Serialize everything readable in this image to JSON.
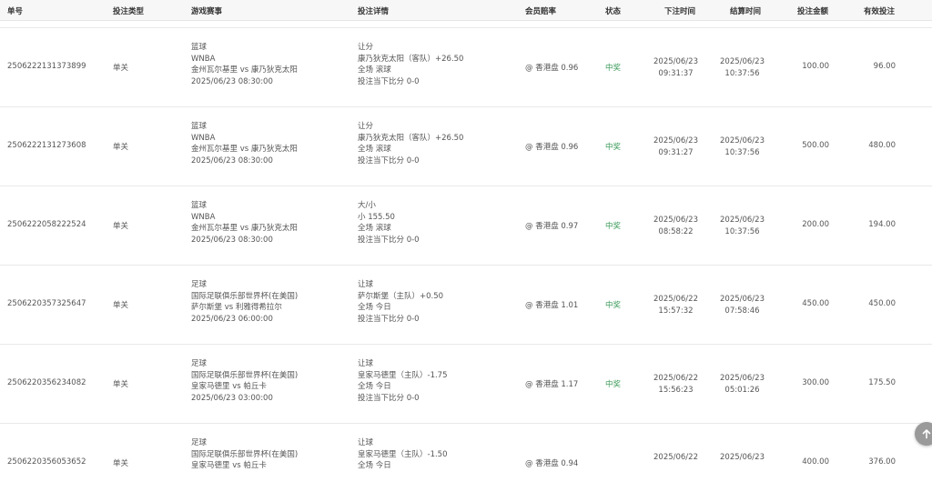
{
  "columns": {
    "order_no": "单号",
    "bet_type": "投注类型",
    "game": "游戏赛事",
    "detail": "投注详情",
    "odds": "会员赔率",
    "status": "状态",
    "bet_time": "下注时间",
    "settle_time": "结算时间",
    "amount": "投注金额",
    "valid": "有效投注"
  },
  "rows": [
    {
      "order_no": "2506222131373899",
      "bet_type": "单关",
      "game": [
        "篮球",
        "WNBA",
        "金州瓦尔基里 vs 康乃狄克太阳",
        "2025/06/23 08:30:00"
      ],
      "detail": [
        "让分",
        "康乃狄克太阳（客队）+26.50",
        "全场 滚球",
        "投注当下比分 0-0"
      ],
      "odds": "@ 香港盘 0.96",
      "status": "中奖",
      "bet_time": [
        "2025/06/23",
        "09:31:37"
      ],
      "settle_time": [
        "2025/06/23",
        "10:37:56"
      ],
      "amount": "100.00",
      "valid": "96.00"
    },
    {
      "order_no": "2506222131273608",
      "bet_type": "单关",
      "game": [
        "篮球",
        "WNBA",
        "金州瓦尔基里 vs 康乃狄克太阳",
        "2025/06/23 08:30:00"
      ],
      "detail": [
        "让分",
        "康乃狄克太阳（客队）+26.50",
        "全场 滚球",
        "投注当下比分 0-0"
      ],
      "odds": "@ 香港盘 0.96",
      "status": "中奖",
      "bet_time": [
        "2025/06/23",
        "09:31:27"
      ],
      "settle_time": [
        "2025/06/23",
        "10:37:56"
      ],
      "amount": "500.00",
      "valid": "480.00"
    },
    {
      "order_no": "2506222058222524",
      "bet_type": "单关",
      "game": [
        "篮球",
        "WNBA",
        "金州瓦尔基里 vs 康乃狄克太阳",
        "2025/06/23 08:30:00"
      ],
      "detail": [
        "大/小",
        "小 155.50",
        "全场 滚球",
        "投注当下比分 0-0"
      ],
      "odds": "@ 香港盘 0.97",
      "status": "中奖",
      "bet_time": [
        "2025/06/23",
        "08:58:22"
      ],
      "settle_time": [
        "2025/06/23",
        "10:37:56"
      ],
      "amount": "200.00",
      "valid": "194.00"
    },
    {
      "order_no": "2506220357325647",
      "bet_type": "单关",
      "game": [
        "足球",
        "国际足联俱乐部世界杯(在美国)",
        "萨尔斯堡 vs 利雅得希拉尔",
        "2025/06/23 06:00:00"
      ],
      "detail": [
        "让球",
        "萨尔斯堡（主队）+0.50",
        "全场 今日",
        "投注当下比分 0-0"
      ],
      "odds": "@ 香港盘 1.01",
      "status": "中奖",
      "bet_time": [
        "2025/06/22",
        "15:57:32"
      ],
      "settle_time": [
        "2025/06/23",
        "07:58:46"
      ],
      "amount": "450.00",
      "valid": "450.00"
    },
    {
      "order_no": "2506220356234082",
      "bet_type": "单关",
      "game": [
        "足球",
        "国际足联俱乐部世界杯(在美国)",
        "皇家马德里 vs 帕丘卡",
        "2025/06/23 03:00:00"
      ],
      "detail": [
        "让球",
        "皇家马德里（主队）-1.75",
        "全场 今日",
        "投注当下比分 0-0"
      ],
      "odds": "@ 香港盘 1.17",
      "status": "中奖",
      "bet_time": [
        "2025/06/22",
        "15:56:23"
      ],
      "settle_time": [
        "2025/06/23",
        "05:01:26"
      ],
      "amount": "300.00",
      "valid": "175.50"
    },
    {
      "order_no": "2506220356053652",
      "bet_type": "单关",
      "game": [
        "足球",
        "国际足联俱乐部世界杯(在美国)",
        "皇家马德里 vs 帕丘卡",
        ""
      ],
      "detail": [
        "让球",
        "皇家马德里（主队）-1.50",
        "全场 今日",
        ""
      ],
      "odds": "@ 香港盘 0.94",
      "status": "",
      "bet_time": [
        "2025/06/22",
        ""
      ],
      "settle_time": [
        "2025/06/23",
        ""
      ],
      "amount": "400.00",
      "valid": "376.00"
    }
  ],
  "scroll_top_icon": "arrow-up-icon"
}
